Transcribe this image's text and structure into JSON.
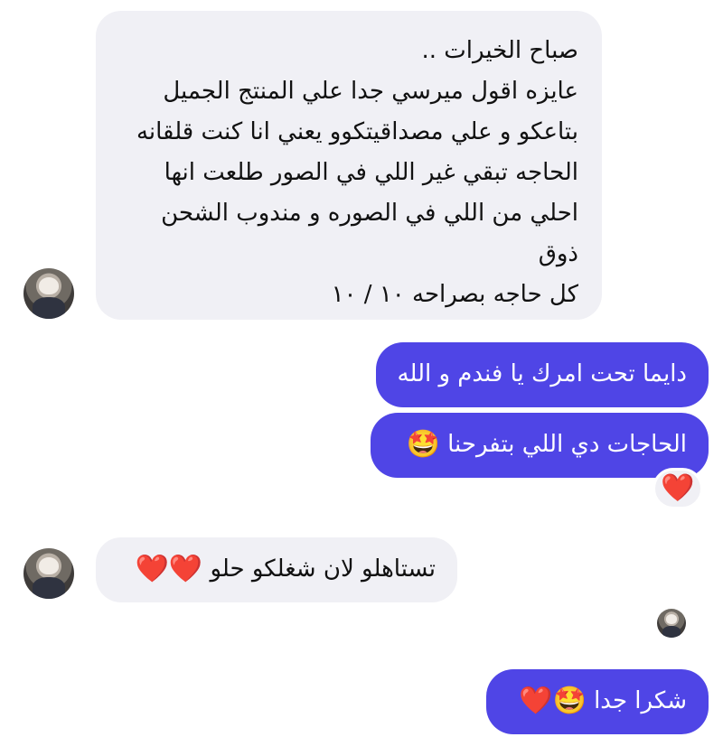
{
  "messages": [
    {
      "id": "m1",
      "direction": "incoming",
      "lines": [
        "صباح الخيرات ..",
        "عايزه اقول ميرسي جدا علي المنتج الجميل",
        "بتاعكو و علي مصداقيتكوو يعني انا كنت قلقانه",
        "الحاجه تبقي غير اللي في الصور طلعت انها",
        "احلي من اللي في الصوره و مندوب الشحن",
        "ذوق",
        "كل حاجه بصراحه ١٠ / ١٠"
      ]
    },
    {
      "id": "m2",
      "direction": "outgoing",
      "text": "دايما تحت امرك يا فندم و الله"
    },
    {
      "id": "m3",
      "direction": "outgoing",
      "text": "الحاجات دي اللي بتفرحنا",
      "emoji": "🤩",
      "reaction": "❤️"
    },
    {
      "id": "m4",
      "direction": "incoming",
      "text": "تستاهلو لان شغلكو حلو",
      "emoji": "❤️❤️"
    },
    {
      "id": "m5",
      "direction": "outgoing",
      "text": "شكرا جدا",
      "emoji": "🤩❤️"
    }
  ],
  "colors": {
    "incoming_bubble": "#f0f0f5",
    "outgoing_bubble": "#4f45e6",
    "outgoing_text": "#ffffff",
    "incoming_text": "#111111"
  }
}
